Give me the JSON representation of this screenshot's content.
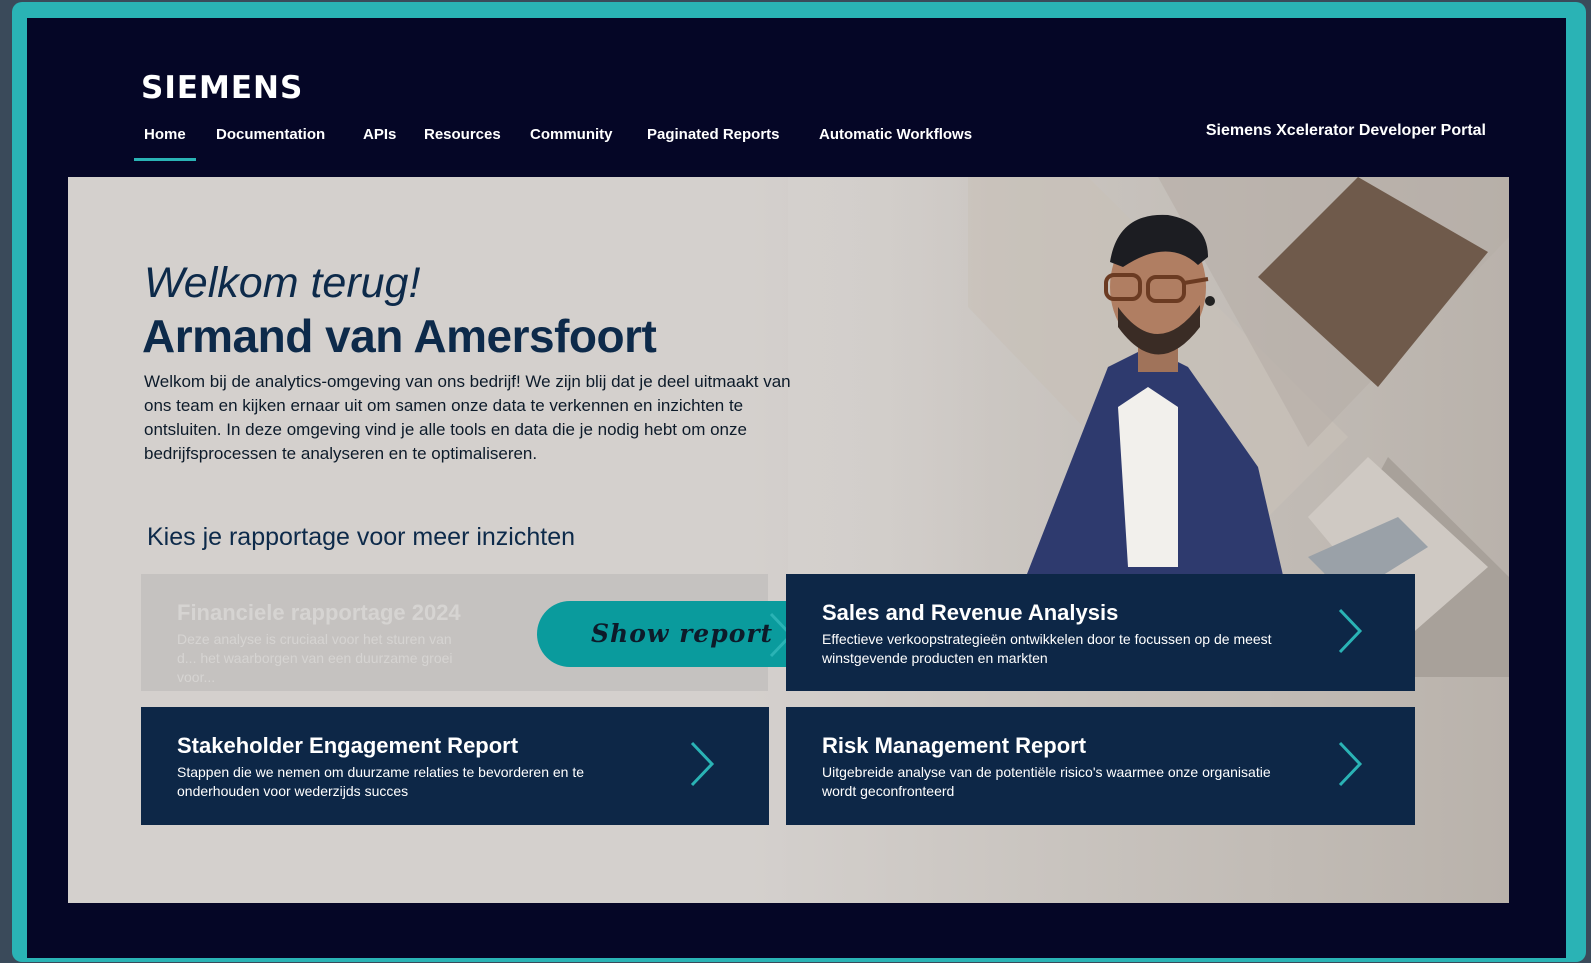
{
  "brand": {
    "logo_text": "SIEMENS",
    "portal_title": "Siemens Xcelerator Developer Portal",
    "accent_color": "#2ab3b5",
    "background_color": "#050626",
    "card_color": "#0d2747"
  },
  "nav": {
    "items": [
      {
        "label": "Home",
        "active": true
      },
      {
        "label": "Documentation"
      },
      {
        "label": "APIs"
      },
      {
        "label": "Resources"
      },
      {
        "label": "Community"
      },
      {
        "label": "Paginated Reports"
      },
      {
        "label": "Automatic Workflows"
      }
    ]
  },
  "hero": {
    "welcome": "Welkom terug!",
    "name": "Armand van Amersfoort",
    "intro": "Welkom bij de analytics-omgeving van ons bedrijf! We zijn blij dat je deel uitmaakt van ons team en kijken ernaar uit om samen onze data te verkennen en inzichten te ontsluiten. In deze omgeving vind je alle tools en data die je nodig hebt om onze bedrijfsprocessen te analyseren en te optimaliseren.",
    "choose_heading": "Kies je rapportage voor meer inzichten"
  },
  "reports": [
    {
      "title": "Financiele rapportage 2024",
      "description": "Deze analyse is cruciaal voor het sturen van d... het waarborgen van een duurzame groei voor...",
      "disabled": true
    },
    {
      "title": "Sales and Revenue Analysis",
      "description": "Effectieve verkoopstrategieën ontwikkelen door te focussen op de meest winstgevende producten en markten"
    },
    {
      "title": "Stakeholder Engagement Report",
      "description": "Stappen die we nemen om duurzame relaties te bevorderen en te onderhouden voor wederzijds succes"
    },
    {
      "title": "Risk Management Report",
      "description": "Uitgebreide analyse van de potentiële risico's waarmee onze organisatie wordt geconfronteerd"
    }
  ],
  "show_report_button": {
    "label": "Show report",
    "icon": "chevron-right-icon"
  }
}
